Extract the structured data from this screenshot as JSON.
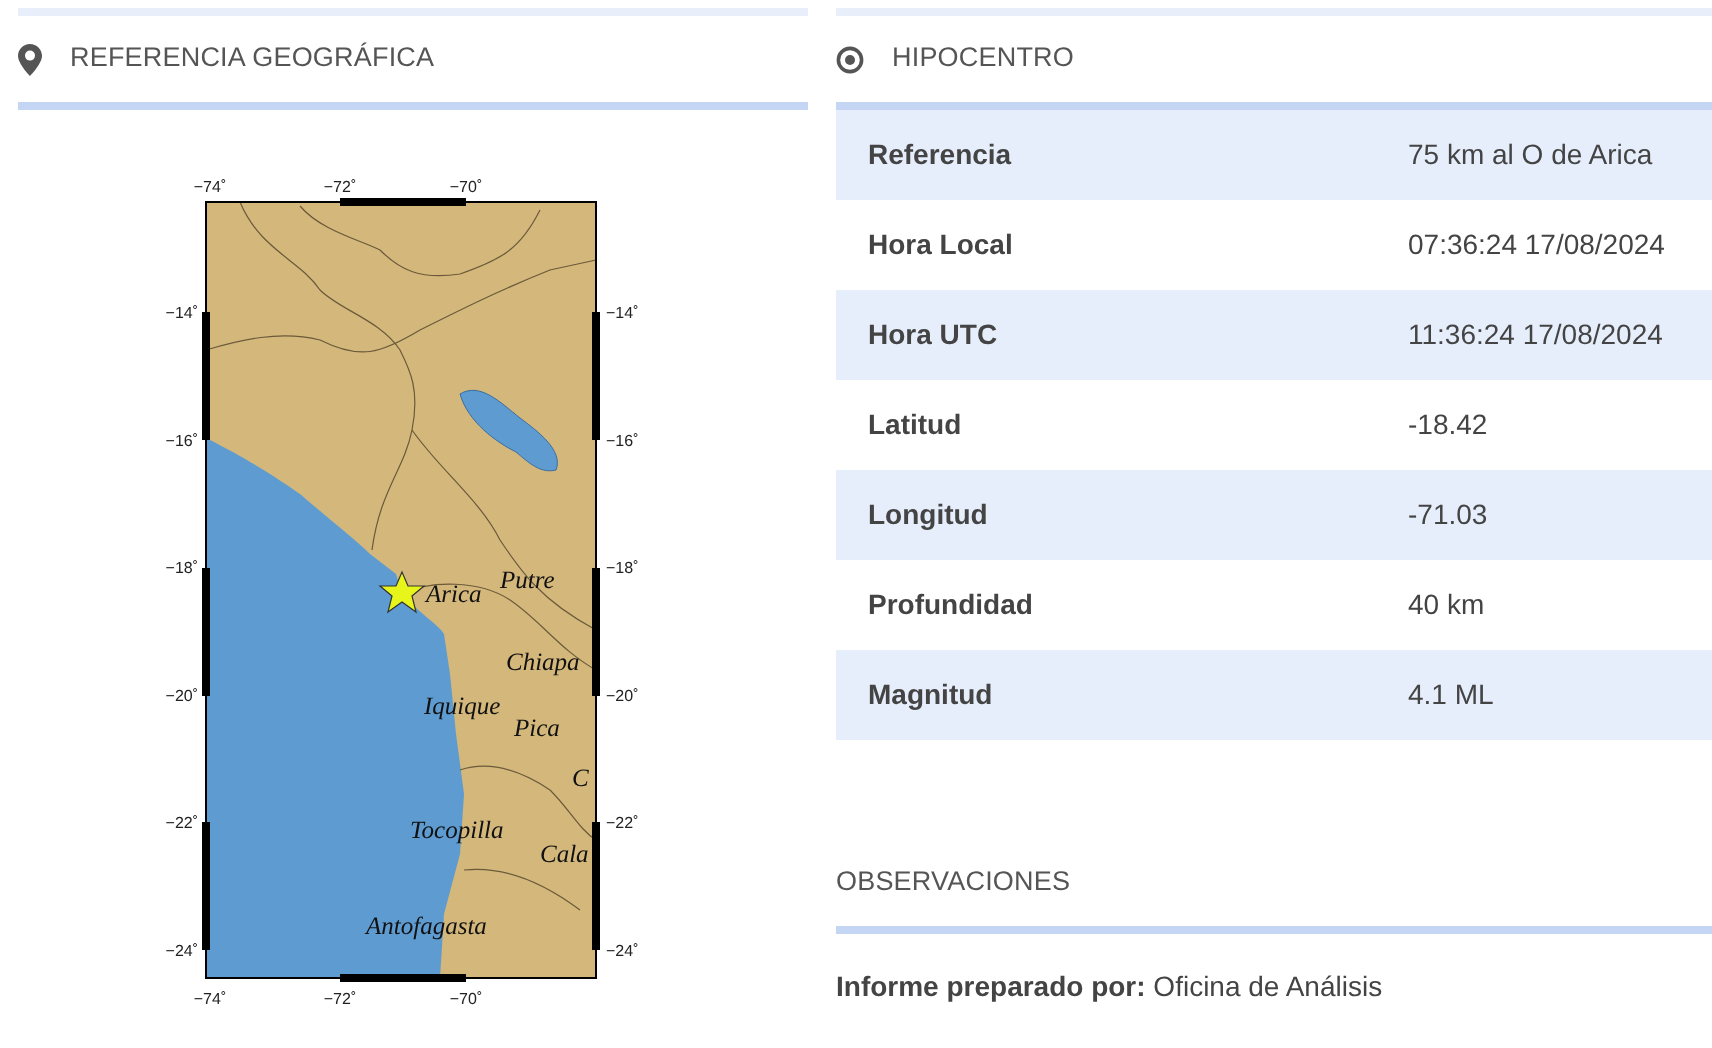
{
  "location_panel": {
    "title": "REFERENCIA GEOGRÁFICA",
    "map": {
      "top_ticks": [
        "−74˚",
        "−72˚",
        "−70˚"
      ],
      "bottom_ticks": [
        "−74˚",
        "−72˚",
        "−70˚"
      ],
      "left_ticks": [
        "−14˚",
        "−16˚",
        "−18˚",
        "−20˚",
        "−22˚",
        "−24˚"
      ],
      "right_ticks": [
        "−14˚",
        "−16˚",
        "−18˚",
        "−20˚",
        "−22˚",
        "−24˚"
      ],
      "places": [
        {
          "name": "Putre"
        },
        {
          "name": "Arica"
        },
        {
          "name": "Chiapa"
        },
        {
          "name": "Iquique"
        },
        {
          "name": "Pica"
        },
        {
          "name": "C"
        },
        {
          "name": "Tocopilla"
        },
        {
          "name": "Cala"
        },
        {
          "name": "Antofagasta"
        }
      ]
    }
  },
  "hypocenter_panel": {
    "title": "HIPOCENTRO",
    "rows": [
      {
        "label": "Referencia",
        "value": "75 km al O de Arica"
      },
      {
        "label": "Hora Local",
        "value": "07:36:24 17/08/2024"
      },
      {
        "label": "Hora UTC",
        "value": "11:36:24 17/08/2024"
      },
      {
        "label": "Latitud",
        "value": "-18.42"
      },
      {
        "label": "Longitud",
        "value": "-71.03"
      },
      {
        "label": "Profundidad",
        "value": "40 km"
      },
      {
        "label": "Magnitud",
        "value": "4.1 ML"
      }
    ]
  },
  "observations_panel": {
    "title": "OBSERVACIONES",
    "text": "**Informe preparado por:** Oficina de Análisis"
  }
}
